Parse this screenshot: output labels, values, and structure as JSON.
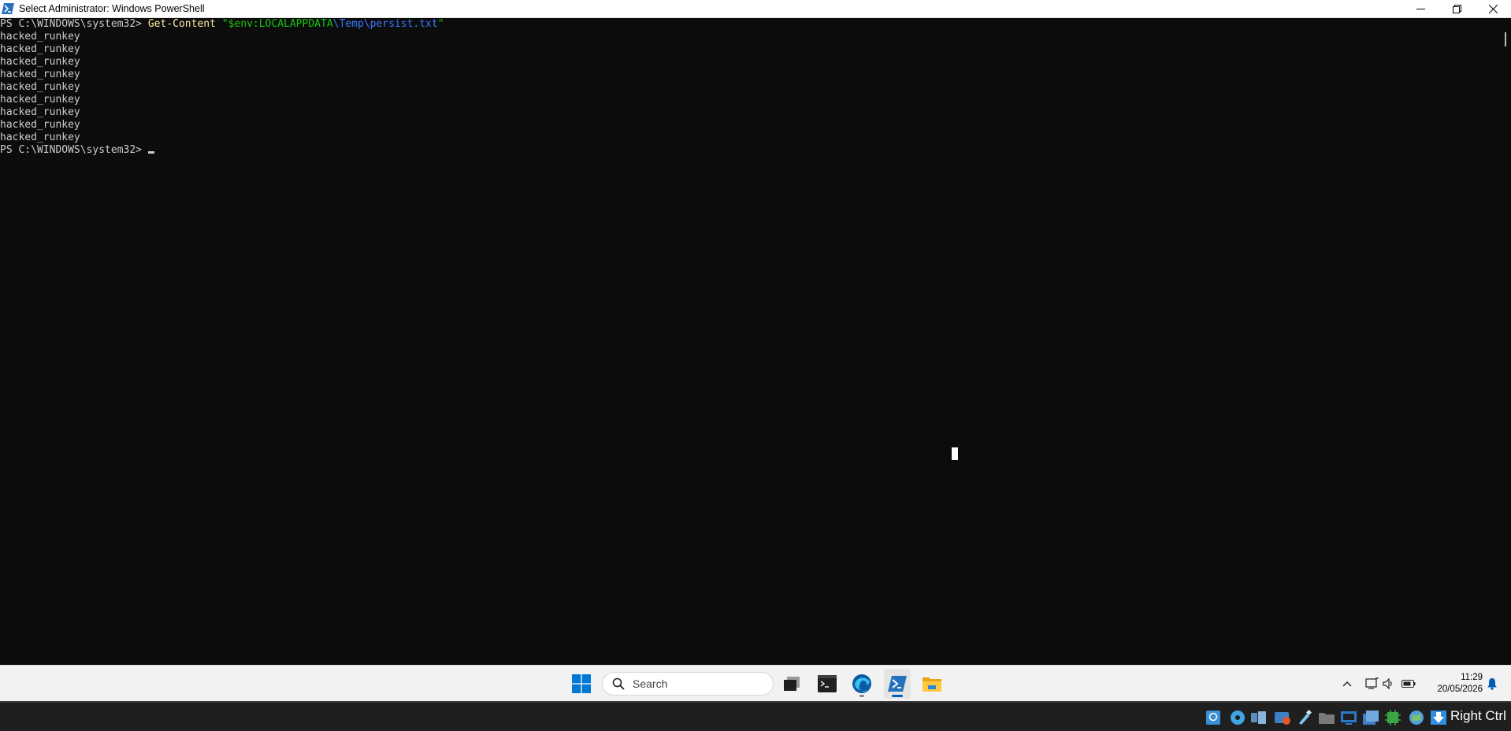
{
  "window": {
    "title": "Select Administrator: Windows PowerShell",
    "icon": "powershell-icon"
  },
  "console": {
    "prompt": "PS C:\\WINDOWS\\system32> ",
    "command": {
      "cmdlet": "Get-Content",
      "arg_open": "\"$env:LOCALAPPDATA",
      "arg_path": "\\Temp\\persist.txt",
      "arg_close": "\""
    },
    "output": [
      "hacked_runkey",
      "hacked_runkey",
      "hacked_runkey",
      "hacked_runkey",
      "hacked_runkey",
      "hacked_runkey",
      "hacked_runkey",
      "hacked_runkey",
      "hacked_runkey"
    ],
    "final_prompt": "PS C:\\WINDOWS\\system32> "
  },
  "taskbar": {
    "search_placeholder": "Search",
    "apps": [
      "start-icon",
      "task-view-icon",
      "terminal-icon",
      "edge-icon",
      "powershell-icon",
      "file-explorer-icon"
    ],
    "clock": {
      "time": "11:29",
      "date": "20/05/2026"
    }
  },
  "hostbar": {
    "host_key": "Right Ctrl"
  },
  "colors": {
    "console_bg": "#0c0c0c",
    "console_fg": "#cccccc",
    "cmdlet": "#f9f1a5",
    "string": "#16c60c",
    "variable": "#3b78ff",
    "taskbar_bg": "#f2f2f2",
    "accent": "#005fb8"
  }
}
